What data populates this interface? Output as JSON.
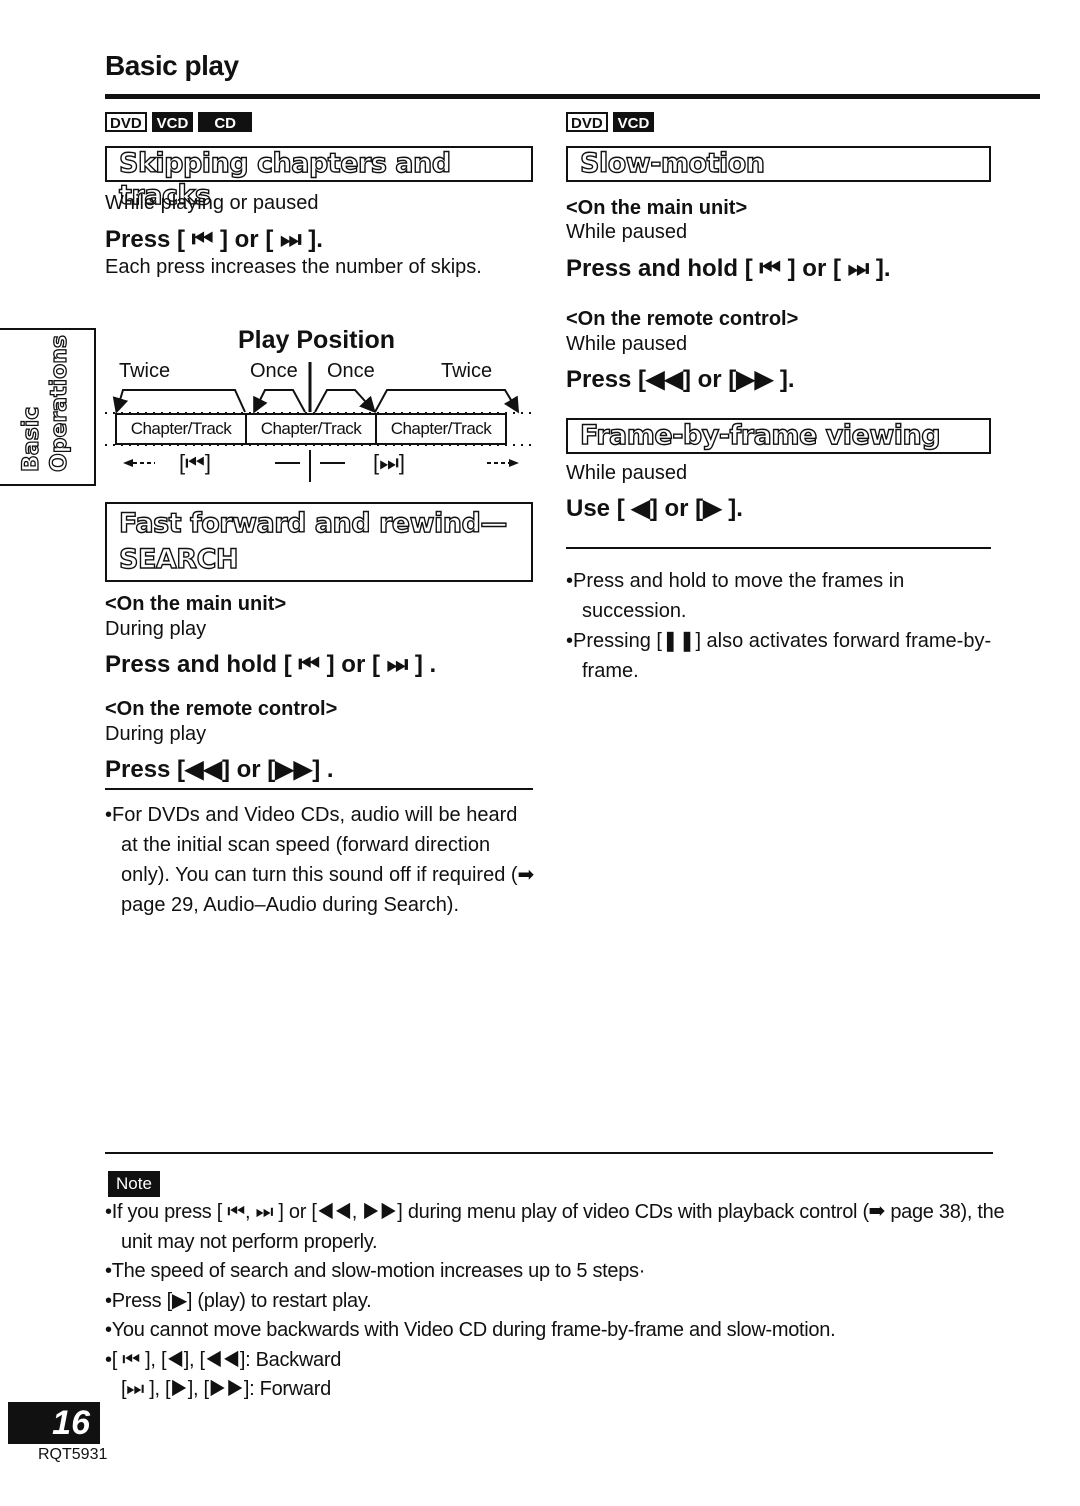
{
  "header": {
    "title": "Basic play"
  },
  "side_tab": {
    "line1": "Basic",
    "line2": "Operations"
  },
  "left": {
    "skip": {
      "badges": [
        "DVD",
        "VCD",
        "CD"
      ],
      "heading": "Skipping chapters and tracks",
      "condition": "While playing or paused",
      "command": "Press [ ⏮ ] or [ ⏭ ].",
      "note": "Each press increases the number of skips."
    },
    "diagram": {
      "title": "Play Position",
      "labels": [
        "Twice",
        "Once",
        "Once",
        "Twice"
      ],
      "tracks": [
        "Chapter/Track",
        "Chapter/Track",
        "Chapter/Track"
      ],
      "back_button": "[⏮]",
      "forward_button": "[⏭]"
    },
    "search": {
      "heading_line1": "Fast forward and rewind—",
      "heading_line2": "SEARCH",
      "main_unit_label": "<On the main unit>",
      "main_unit_condition": "During play",
      "main_unit_command": "Press and hold [ ⏮ ] or [ ⏭ ] .",
      "remote_label": "<On the remote control>",
      "remote_condition": "During play",
      "remote_command": "Press [◀◀] or [▶▶] .",
      "bullets": [
        "•For DVDs and Video CDs, audio will be heard at the initial scan speed (forward direction only). You can turn this sound off if required (➡ page 29, Audio–Audio during Search)."
      ]
    }
  },
  "right": {
    "slow": {
      "badges": [
        "DVD",
        "VCD"
      ],
      "heading": "Slow-motion",
      "main_unit_label": "<On the main unit>",
      "main_unit_condition": "While paused",
      "main_unit_command": "Press and hold [ ⏮ ] or [ ⏭ ].",
      "remote_label": "<On the remote control>",
      "remote_condition": "While paused",
      "remote_command": "Press [◀◀] or [▶▶ ]."
    },
    "frame": {
      "heading": "Frame-by-frame viewing",
      "condition": "While paused",
      "command": "Use [ ◀] or [▶ ].",
      "bullets": [
        "•Press and hold to move the frames in succession.",
        "•Pressing [❚❚] also activates forward frame-by-frame."
      ]
    }
  },
  "note": {
    "label": "Note",
    "bullets": [
      "•If you press [ ⏮, ⏭ ] or [◀◀, ▶▶] during menu play of video CDs with playback control (➡ page 38), the unit may not perform properly.",
      "•The speed of search and slow-motion increases up to 5 steps·",
      "•Press [▶] (play) to restart play.",
      "•You cannot move backwards with Video CD during frame-by-frame and slow-motion.",
      "•[ ⏮ ], [◀], [◀◀]: Backward",
      "[⏭ ], [▶], [▶▶]: Forward"
    ]
  },
  "footer": {
    "page_number": "16",
    "model_code": "RQT5931"
  }
}
